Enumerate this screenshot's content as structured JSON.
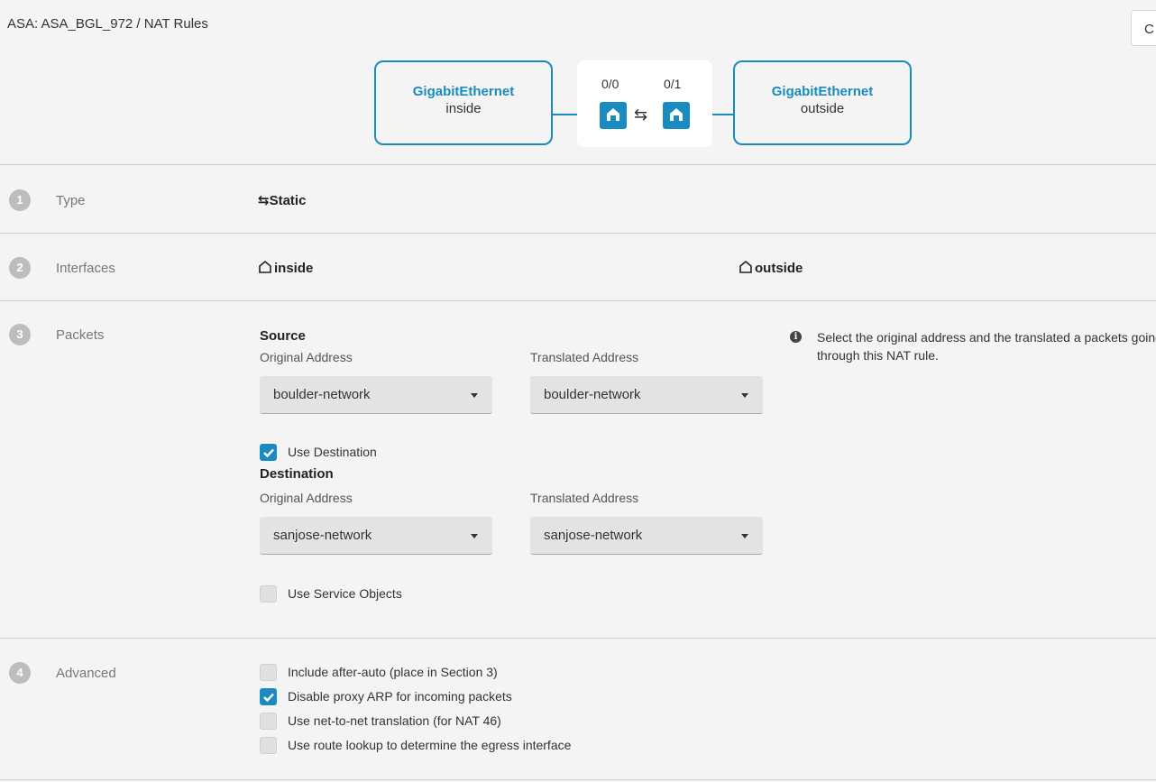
{
  "header": {
    "breadcrumb": "ASA: ASA_BGL_972 / NAT Rules",
    "corner_button": "C",
    "left_interface": {
      "name": "GigabitEthernet",
      "zone": "inside",
      "port": "0/0"
    },
    "right_interface": {
      "name": "GigabitEthernet",
      "zone": "outside",
      "port": "0/1"
    }
  },
  "sections": {
    "type": {
      "step": "1",
      "label": "Type",
      "value": "Static"
    },
    "interfaces": {
      "step": "2",
      "label": "Interfaces",
      "source": "inside",
      "destination": "outside"
    },
    "packets": {
      "step": "3",
      "label": "Packets",
      "source_heading": "Source",
      "source_original_label": "Original Address",
      "source_original_value": "boulder-network",
      "source_translated_label": "Translated Address",
      "source_translated_value": "boulder-network",
      "use_destination": {
        "label": "Use Destination",
        "checked": true
      },
      "destination_heading": "Destination",
      "dest_original_label": "Original Address",
      "dest_original_value": "sanjose-network",
      "dest_translated_label": "Translated Address",
      "dest_translated_value": "sanjose-network",
      "use_service_objects": {
        "label": "Use Service Objects",
        "checked": false
      },
      "info_text": "Select the original address and the translated a packets going through this NAT rule."
    },
    "advanced": {
      "step": "4",
      "label": "Advanced",
      "options": [
        {
          "label": "Include after-auto (place in Section 3)",
          "checked": false
        },
        {
          "label": "Disable proxy ARP for incoming packets",
          "checked": true
        },
        {
          "label": "Use net-to-net translation (for NAT 46)",
          "checked": false
        },
        {
          "label": "Use route lookup to determine the egress interface",
          "checked": false
        }
      ]
    }
  },
  "colors": {
    "accent": "#1a8bbf",
    "step_badge": "#bdbdbd",
    "field_bg": "#e3e3e3"
  },
  "icons": {
    "static": "swap-arrows-icon",
    "interface": "house-outline-icon",
    "port": "ethernet-port-icon",
    "info": "info-circle-icon",
    "dropdown": "caret-down-icon"
  }
}
